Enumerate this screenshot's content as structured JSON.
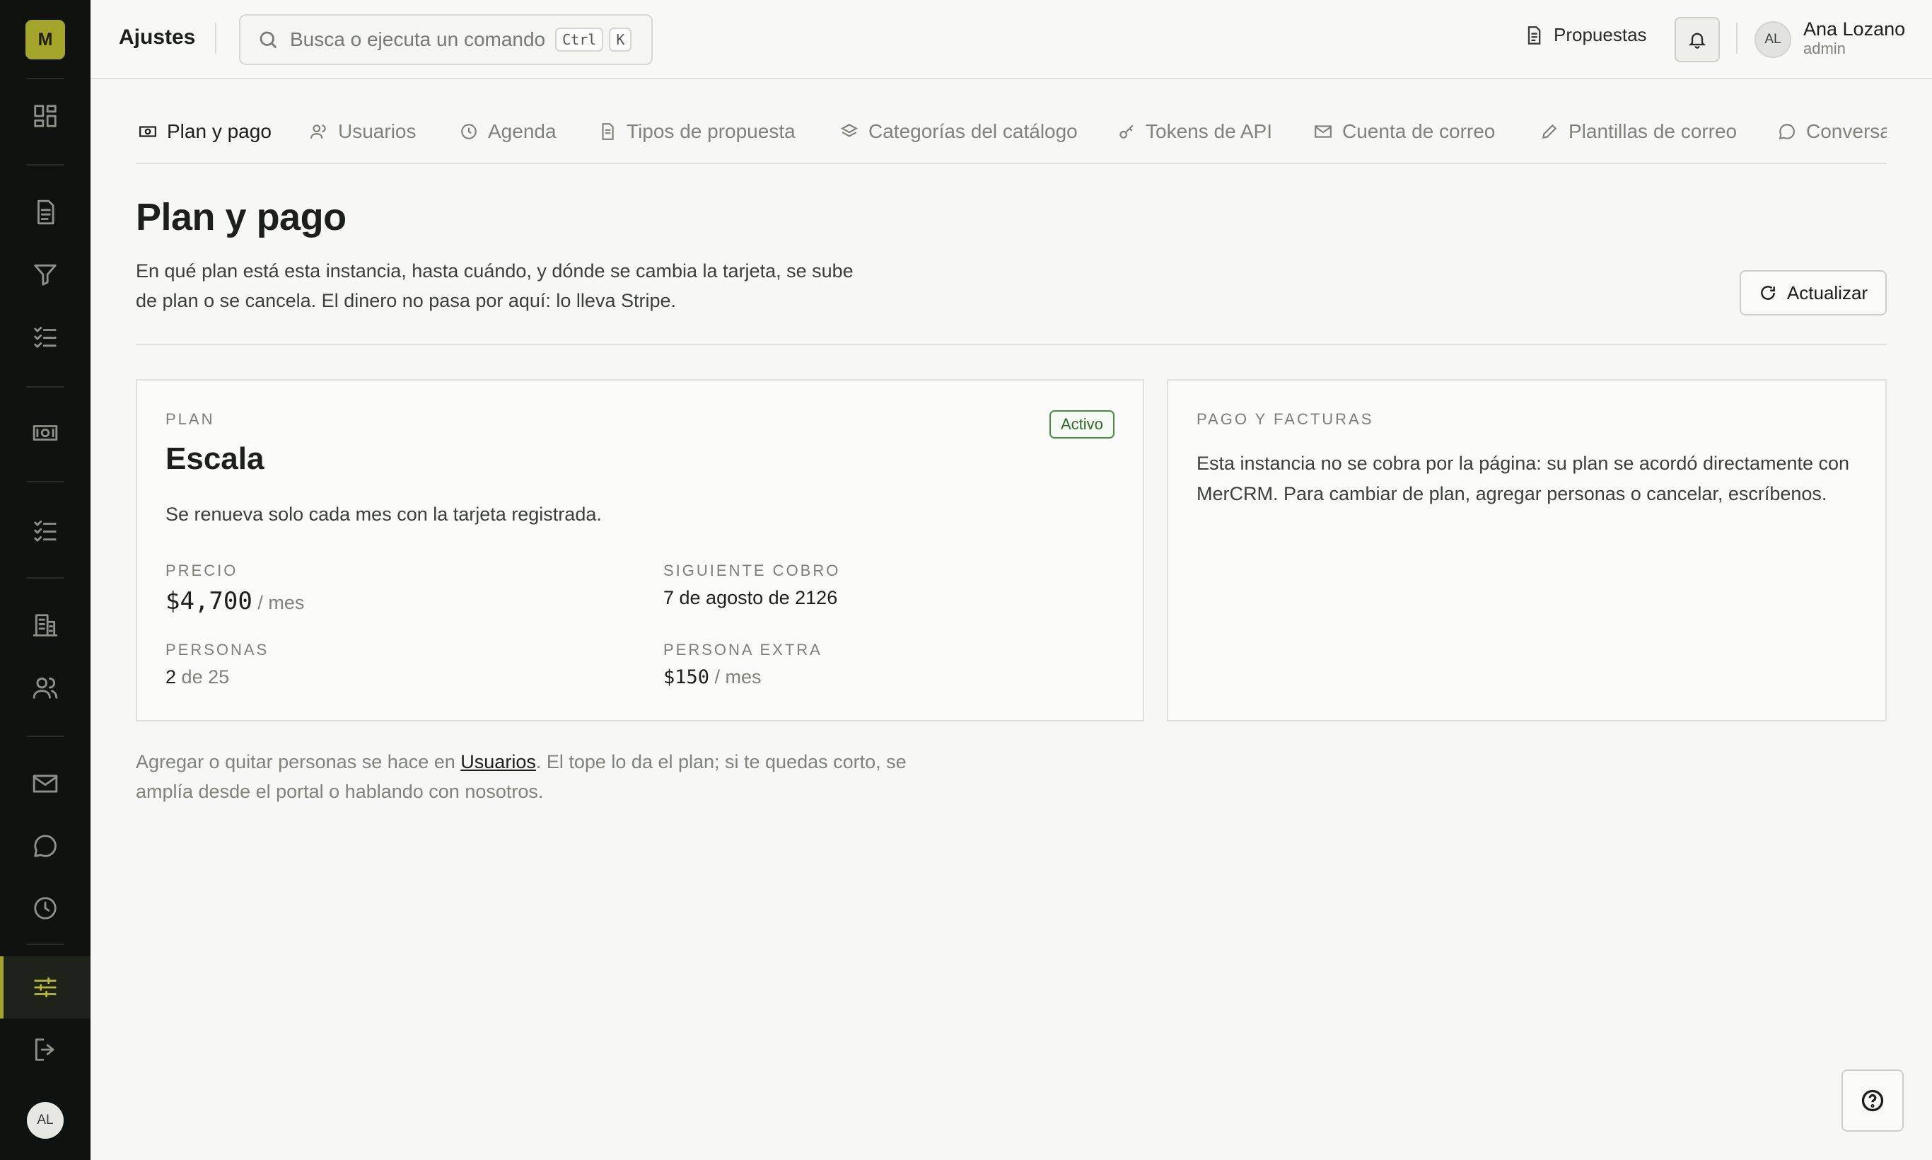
{
  "app": {
    "logo_letter": "M",
    "user_initials": "AL"
  },
  "topbar": {
    "title": "Ajustes",
    "search_placeholder": "Busca o ejecuta un comando",
    "kbd_ctrl": "Ctrl",
    "kbd_k": "K",
    "proposals_link": "Propuestas",
    "user_initials": "AL",
    "user_name": "Ana Lozano",
    "user_role": "admin"
  },
  "sidebar": {
    "icons": [
      "dashboard-icon",
      "document-icon",
      "filter-icon",
      "checklist-icon",
      "money-icon",
      "tasks-icon",
      "building-icon",
      "users-icon",
      "mail-icon",
      "chat-icon",
      "clock-icon",
      "settings-icon",
      "logout-icon"
    ],
    "active": "settings-icon"
  },
  "tabs": [
    {
      "label": "Plan y pago",
      "icon": "money-icon",
      "active": true
    },
    {
      "label": "Usuarios",
      "icon": "users-icon"
    },
    {
      "label": "Agenda",
      "icon": "clock-icon"
    },
    {
      "label": "Tipos de propuesta",
      "icon": "document-icon"
    },
    {
      "label": "Categorías del catálogo",
      "icon": "layers-icon"
    },
    {
      "label": "Tokens de API",
      "icon": "key-icon"
    },
    {
      "label": "Cuenta de correo",
      "icon": "mail-icon"
    },
    {
      "label": "Plantillas de correo",
      "icon": "pencil-icon"
    },
    {
      "label": "Conversaciones",
      "icon": "chat-icon"
    }
  ],
  "page": {
    "title": "Plan y pago",
    "description": "En qué plan está esta instancia, hasta cuándo, y dónde se cambia la tarjeta, se sube de plan o se cancela. El dinero no pasa por aquí: lo lleva Stripe.",
    "refresh_label": "Actualizar"
  },
  "plan_card": {
    "caption": "PLAN",
    "badge": "Activo",
    "name": "Escala",
    "subtitle": "Se renueva solo cada mes con la tarjeta registrada.",
    "price_label": "PRECIO",
    "price_value": "$4,700",
    "price_unit": "/ mes",
    "next_label": "SIGUIENTE COBRO",
    "next_value": "7 de agosto de 2126",
    "people_label": "PERSONAS",
    "people_count": "2",
    "people_of": "de 25",
    "extra_label": "PERSONA EXTRA",
    "extra_value": "$150",
    "extra_unit": "/ mes"
  },
  "pay_card": {
    "caption": "PAGO Y FACTURAS",
    "text": "Esta instancia no se cobra por la página: su plan se acordó directamente con MerCRM. Para cambiar de plan, agregar personas o cancelar, escríbenos."
  },
  "note": {
    "before": "Agregar o quitar personas se hace en ",
    "link": "Usuarios",
    "after": ". El tope lo da el plan; si te quedas corto, se amplía desde el portal o hablando con nosotros."
  }
}
